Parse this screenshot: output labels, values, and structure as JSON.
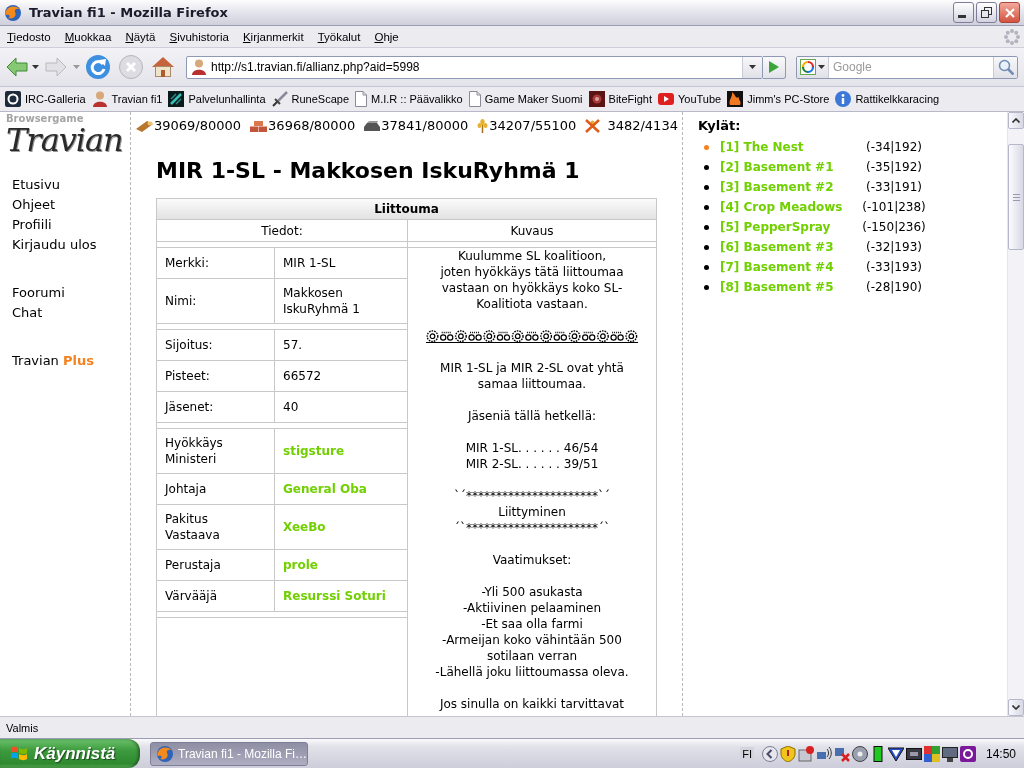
{
  "window": {
    "title": "Travian fi1 - Mozilla Firefox"
  },
  "menu_bar": [
    "Tiedosto",
    "Muokkaa",
    "Näytä",
    "Sivuhistoria",
    "Kirjanmerkit",
    "Työkalut",
    "Ohje"
  ],
  "navigation": {
    "url": "http://s1.travian.fi/allianz.php?aid=5998",
    "search": {
      "placeholder": "Google"
    }
  },
  "bookmarks": [
    {
      "kind": "ring",
      "label": "IRC-Galleria"
    },
    {
      "kind": "avatar",
      "label": "Travian fi1"
    },
    {
      "kind": "tile",
      "label": "Palvelunhallinta"
    },
    {
      "kind": "sword",
      "label": "RuneScape"
    },
    {
      "kind": "page",
      "label": "M.I.R :: Päävalikko"
    },
    {
      "kind": "page",
      "label": "Game Maker Suomi"
    },
    {
      "kind": "emblem",
      "label": "BiteFight"
    },
    {
      "kind": "video",
      "label": "YouTube"
    },
    {
      "kind": "flame",
      "label": "Jimm's PC-Store"
    },
    {
      "kind": "info",
      "label": "Rattikelkkaracing"
    }
  ],
  "page": {
    "logo": {
      "tagline": "Browsergame",
      "name": "Travian"
    },
    "sidebar": {
      "groups": [
        {
          "items": [
            {
              "label": "Etusivu"
            },
            {
              "label": "Ohjeet"
            },
            {
              "label": "Profiili"
            },
            {
              "label": "Kirjaudu ulos"
            }
          ]
        },
        {
          "items": [
            {
              "label": "Foorumi"
            },
            {
              "label": "Chat"
            }
          ]
        },
        {
          "items": [
            {
              "label": "Travian",
              "accent": "Plus"
            }
          ]
        }
      ]
    },
    "resources": [
      {
        "kind": "wood",
        "amount": "39069/80000"
      },
      {
        "kind": "clay",
        "amount": "36968/80000"
      },
      {
        "kind": "iron",
        "amount": "37841/80000"
      },
      {
        "kind": "crop",
        "amount": "34207/55100"
      },
      {
        "kind": "consumption",
        "amount": "3482/4134"
      }
    ],
    "heading": "MIR 1-SL - Makkosen IskuRyhmä 1",
    "alliance_table": {
      "title": "Liittouma",
      "columns": [
        "Tiedot:",
        "Kuvaus"
      ],
      "detail_groups": [
        {
          "rows": [
            {
              "kind": "text",
              "label": "Merkki:",
              "value": "MIR 1-SL"
            },
            {
              "kind": "text",
              "label": "Nimi:",
              "value": "Makkosen IskuRyhmä 1"
            }
          ]
        },
        {
          "rows": [
            {
              "kind": "text",
              "label": "Sijoitus:",
              "value": "57."
            },
            {
              "kind": "text",
              "label": "Pisteet:",
              "value": "66572"
            },
            {
              "kind": "text",
              "label": "Jäsenet:",
              "value": "40"
            }
          ]
        },
        {
          "rows": [
            {
              "kind": "link",
              "label": "Hyökkäys Ministeri",
              "value": "stigsture"
            },
            {
              "kind": "link",
              "label": "Johtaja",
              "value": "General Oba"
            },
            {
              "kind": "link",
              "label": "Pakitus Vastaava",
              "value": "XeeBo"
            },
            {
              "kind": "link",
              "label": "Perustaja",
              "value": "prole"
            },
            {
              "kind": "link",
              "label": "Värvääjä",
              "value": "Resurssi Soturi"
            }
          ]
        }
      ],
      "description": [
        {
          "kind": "text",
          "lines": [
            "Kuulumme SL koalitioon,",
            "joten hyökkäys tätä liittoumaa",
            "vastaan on hyökkäys koko SL-",
            "Koalitiota vastaan."
          ]
        },
        {
          "kind": "ornament"
        },
        {
          "kind": "text",
          "lines": [
            "MIR 1-SL ja MIR 2-SL ovat yhtä",
            "samaa liittoumaa."
          ]
        },
        {
          "kind": "text",
          "lines": [
            "Jäseniä tällä hetkellä:"
          ]
        },
        {
          "kind": "text",
          "lines": [
            "MIR 1-SL. . . . . . 46/54",
            "MIR 2-SL. . . . . . 39/51"
          ]
        },
        {
          "kind": "text",
          "lines": [
            "`´**********************`´",
            "Liittyminen",
            "´`**********************´`"
          ]
        },
        {
          "kind": "text",
          "lines": [
            "Vaatimukset:"
          ]
        },
        {
          "kind": "text",
          "lines": [
            "-Yli 500 asukasta",
            "-Aktiivinen pelaaminen",
            "-Et saa olla farmi",
            "-Armeijan koko vähintään 500",
            "sotilaan verran",
            "-Lähellä joku liittoumassa oleva."
          ]
        },
        {
          "kind": "text",
          "lines": [
            "Jos sinulla on kaikki tarvittavat"
          ]
        }
      ]
    },
    "villages": {
      "title": "Kylät:",
      "items": [
        {
          "name": "[1] The Nest",
          "coordinates": "(-34|192)",
          "selected": true
        },
        {
          "name": "[2] Basement #1",
          "coordinates": "(-35|192)",
          "selected": false
        },
        {
          "name": "[3] Basement #2",
          "coordinates": "(-33|191)",
          "selected": false
        },
        {
          "name": "[4] Crop Meadows",
          "coordinates": "(-101|238)",
          "selected": false
        },
        {
          "name": "[5] PepperSpray",
          "coordinates": "(-150|236)",
          "selected": false
        },
        {
          "name": "[6] Basement #3",
          "coordinates": "(-32|193)",
          "selected": false
        },
        {
          "name": "[7] Basement #4",
          "coordinates": "(-33|193)",
          "selected": false
        },
        {
          "name": "[8] Basement #5",
          "coordinates": "(-28|190)",
          "selected": false
        }
      ]
    }
  },
  "status_bar": {
    "text": "Valmis"
  },
  "taskbar": {
    "start": "Käynnistä",
    "tasks": [
      {
        "label": "Travian fi1 - Mozilla Fi…",
        "selected": true
      }
    ],
    "language": "FI",
    "clock": "14:50"
  }
}
